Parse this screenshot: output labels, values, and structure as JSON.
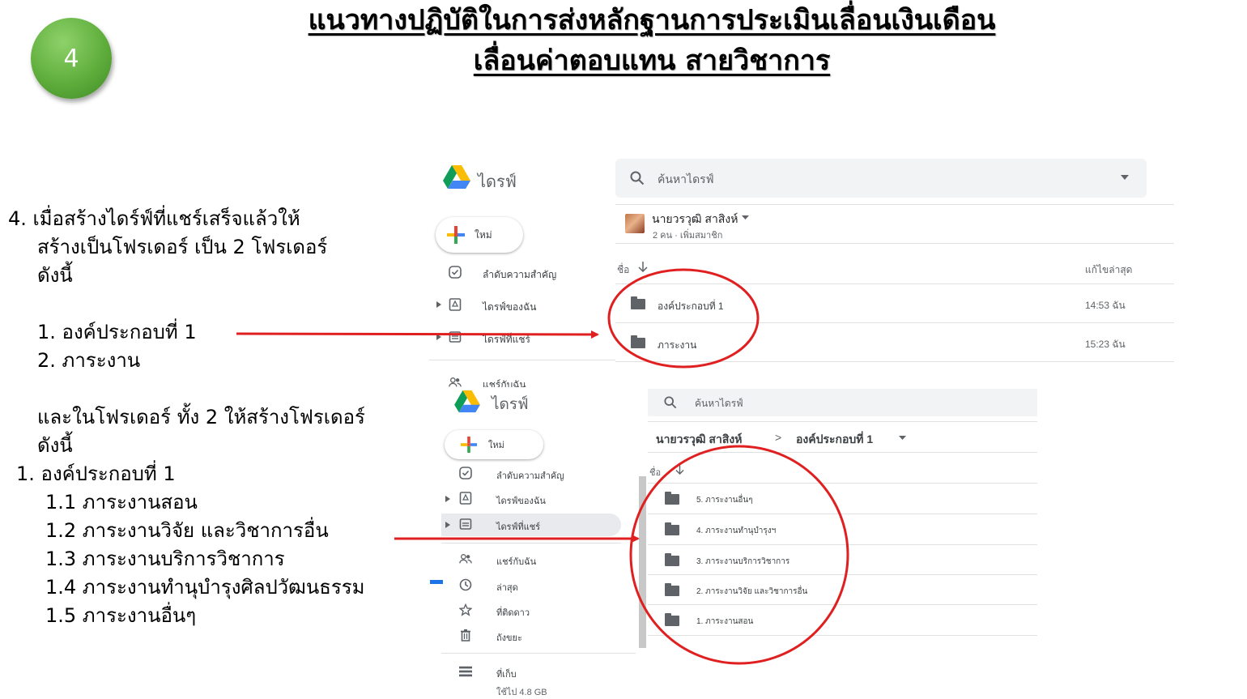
{
  "slide": {
    "badge": "4",
    "title_line1": "แนวทางปฏิบัติในการส่งหลักฐานการประเมินเลื่อนเงินเดือน",
    "title_line2": "เลื่อนค่าตอบแทน สายวิชาการ"
  },
  "instructions": {
    "intro_1": "4. เมื่อสร้างไดร์ฟ์ที่แชร์เสร็จแล้วให้",
    "intro_2": "สร้างเป็นโฟรเดอร์ เป็น 2 โฟรเดอร์",
    "intro_3": "ดังนี้",
    "folders": [
      "1. องค์ประกอบที่ 1",
      "2. ภาระงาน"
    ],
    "sub_intro_1": "และในโฟรเดอร์ ทั้ง 2 ให้สร้างโฟรเดอร์",
    "sub_intro_2": "ดังนี้",
    "sub_heading": "1. องค์ประกอบที่ 1",
    "sub_items": [
      "1.1 ภาระงานสอน",
      "1.2 ภาระงานวิจัย และวิชาการอื่น",
      "1.3 ภาระงานบริการวิชาการ",
      "1.4 ภาระงานทำนุบำรุงศิลปวัฒนธรรม",
      "1.5 ภาระงานอื่นๆ"
    ]
  },
  "drive_1": {
    "brand": "ไดรฟ์",
    "search_placeholder": "ค้นหาไดรฟ์",
    "new_label": "ใหม่",
    "nav": [
      "ลำดับความสำคัญ",
      "ไดรฟ์ของฉัน",
      "ไดรฟ์ที่แชร์",
      "แชร์กับฉัน"
    ],
    "shared_drive_name": "นายวรวุฒิ สาสิงห์",
    "members": "2 คน · เพิ่มสมาชิก",
    "col_name": "ชื่อ",
    "col_modified": "แก้ไขล่าสุด",
    "rows": [
      {
        "name": "องค์ประกอบที่ 1",
        "modified": "14:53 ฉัน"
      },
      {
        "name": "ภาระงาน",
        "modified": "15:23 ฉัน"
      }
    ]
  },
  "drive_2": {
    "brand": "ไดรฟ์",
    "search_placeholder": "ค้นหาไดรฟ์",
    "new_label": "ใหม่",
    "nav": [
      "ลำดับความสำคัญ",
      "ไดรฟ์ของฉัน",
      "ไดรฟ์ที่แชร์",
      "แชร์กับฉัน",
      "ล่าสุด",
      "ที่ติดดาว",
      "ถังขยะ",
      "ที่เก็บ"
    ],
    "storage": "ใช้ไป 4.8 GB",
    "breadcrumb_root": "นายวรวุฒิ สาสิงห์",
    "breadcrumb_sep": ">",
    "breadcrumb_current": "องค์ประกอบที่ 1",
    "col_name": "ชื่อ",
    "rows": [
      {
        "name": "5. ภาระงานอื่นๆ"
      },
      {
        "name": "4. ภาระงานทำนุบำรุงฯ"
      },
      {
        "name": "3. ภาระงานบริการวิชาการ"
      },
      {
        "name": "2. ภาระงานวิจัย และวิชาการอื่น"
      },
      {
        "name": "1. ภาระงานสอน"
      }
    ]
  },
  "colors": {
    "annotation_red": "#e02020",
    "badge_green": "#5fae3c"
  }
}
